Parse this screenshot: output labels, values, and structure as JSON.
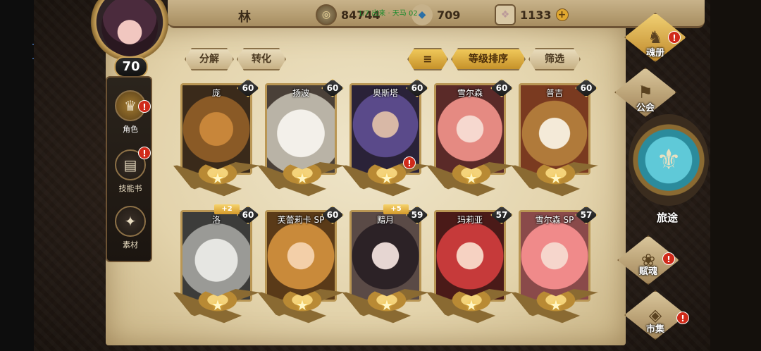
{
  "player": {
    "name": "林",
    "level": "70"
  },
  "resources": {
    "coins": "84744",
    "gems": "709",
    "crystals": "1133",
    "plus": "+",
    "overlay": "1/7 出来 · 天马 02"
  },
  "sidebar": {
    "items": [
      {
        "label": "角色",
        "icon": "character-icon",
        "alert": "!"
      },
      {
        "label": "技能书",
        "icon": "skillbook-icon",
        "alert": "!"
      },
      {
        "label": "素材",
        "icon": "material-icon",
        "alert": ""
      }
    ]
  },
  "toolbar": {
    "decompose": "分解",
    "convert": "转化",
    "sort_icon": "≡",
    "sort_by_level": "等级排序",
    "filter": "筛选"
  },
  "heroes": [
    {
      "name": "庞",
      "level": "60",
      "bonus": "",
      "alert": "",
      "art": "tiger"
    },
    {
      "name": "扬波",
      "level": "60",
      "bonus": "",
      "alert": "",
      "art": "white"
    },
    {
      "name": "奥斯塔",
      "level": "60",
      "bonus": "",
      "alert": "!",
      "art": "purple"
    },
    {
      "name": "雪尔森",
      "level": "60",
      "bonus": "",
      "alert": "",
      "art": "pink"
    },
    {
      "name": "普吉",
      "level": "60",
      "bonus": "",
      "alert": "",
      "art": "owl"
    },
    {
      "name": "洛",
      "level": "60",
      "bonus": "+2",
      "alert": "",
      "art": "wolf"
    },
    {
      "name": "芙蕾莉卡 SP",
      "level": "60",
      "bonus": "",
      "alert": "",
      "art": "blonde"
    },
    {
      "name": "黯月",
      "level": "59",
      "bonus": "+5",
      "alert": "",
      "art": "dark"
    },
    {
      "name": "玛莉亚",
      "level": "57",
      "bonus": "",
      "alert": "",
      "art": "red"
    },
    {
      "name": "雪尔森 SP",
      "level": "57",
      "bonus": "",
      "alert": "",
      "art": "pink2"
    }
  ],
  "right_menu": {
    "soul_book": "魂册",
    "guild": "公会",
    "journey": "旅途",
    "talent": "赋魂",
    "market": "市集",
    "alert": "!"
  },
  "colors": {
    "accent_gold": "#d9b660",
    "alert_red": "#d02a1a",
    "parchment": "#e3d3ab"
  }
}
